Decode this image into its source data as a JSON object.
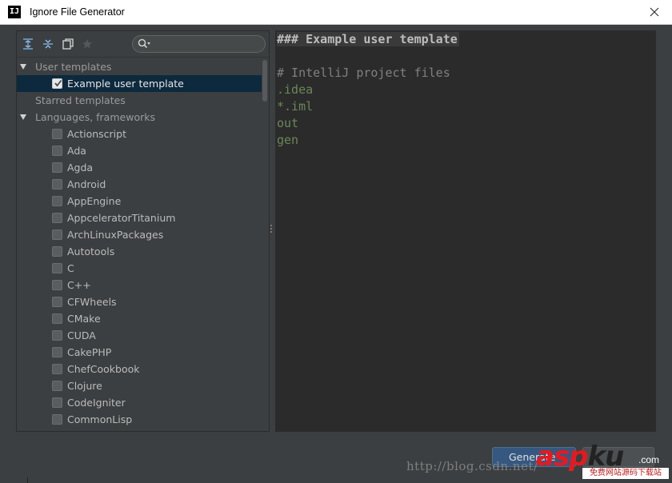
{
  "window": {
    "title": "Ignore File Generator",
    "app_icon_text": "IJ"
  },
  "toolbar": {
    "expand_all_icon": "expand-all-icon",
    "collapse_all_icon": "collapse-all-icon",
    "copy_icon": "copy-icon",
    "star_icon": "star-icon",
    "search_placeholder": ""
  },
  "tree": {
    "user_templates_label": "User templates",
    "example_template_label": "Example user template",
    "starred_templates_label": "Starred templates",
    "languages_label": "Languages, frameworks",
    "languages": [
      "Actionscript",
      "Ada",
      "Agda",
      "Android",
      "AppEngine",
      "AppceleratorTitanium",
      "ArchLinuxPackages",
      "Autotools",
      "C",
      "C++",
      "CFWheels",
      "CMake",
      "CUDA",
      "CakePHP",
      "ChefCookbook",
      "Clojure",
      "CodeIgniter",
      "CommonLisp"
    ]
  },
  "editor": {
    "header": "### Example user template",
    "comment": "# IntelliJ project files",
    "entries": [
      ".idea",
      "*.iml",
      "out",
      "gen"
    ]
  },
  "buttons": {
    "generate": "Generate",
    "cancel": ""
  },
  "watermark": {
    "url": "http://blog.csdn.net/",
    "logo_red": "asp",
    "logo_black": "ku",
    "logo_com": ".com",
    "logo_sub": "免费网站源码下载站"
  },
  "colors": {
    "background": "#3c3f41",
    "editor_bg": "#2b2b2b",
    "selection": "#0d293e",
    "entry_green": "#6a8759",
    "comment_gray": "#808080",
    "button_blue": "#365880"
  }
}
